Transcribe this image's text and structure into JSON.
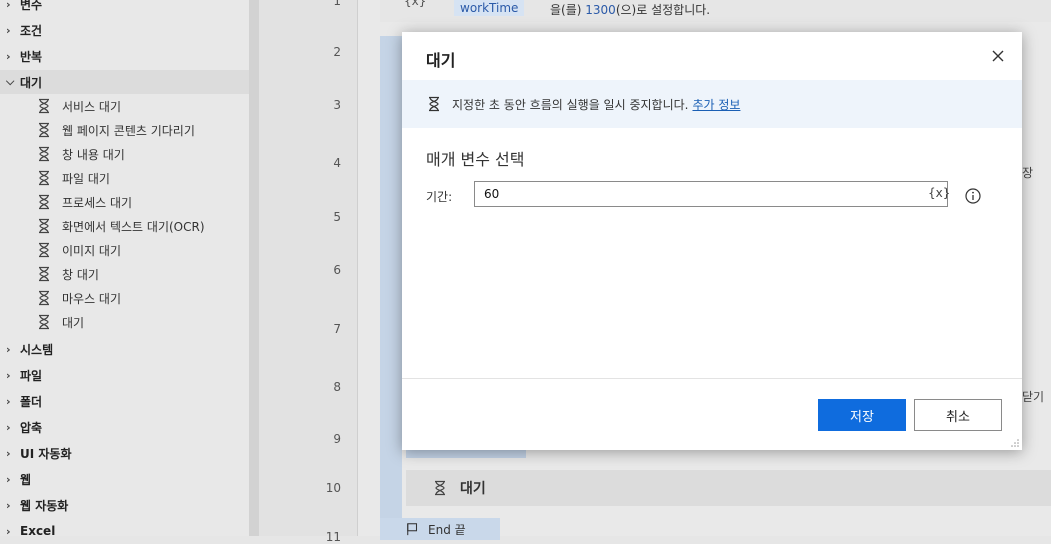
{
  "sidebar": {
    "categories_top": [
      {
        "label": "변수",
        "expanded": false
      },
      {
        "label": "조건",
        "expanded": false
      },
      {
        "label": "반복",
        "expanded": false
      },
      {
        "label": "대기",
        "expanded": true
      }
    ],
    "wait_children": [
      {
        "label": "서비스 대기",
        "icon": "hourglass-icon"
      },
      {
        "label": "웹 페이지 콘텐츠 기다리기",
        "icon": "hourglass-icon"
      },
      {
        "label": "창 내용 대기",
        "icon": "hourglass-icon"
      },
      {
        "label": "파일 대기",
        "icon": "hourglass-icon"
      },
      {
        "label": "프로세스 대기",
        "icon": "hourglass-icon"
      },
      {
        "label": "화면에서 텍스트 대기(OCR)",
        "icon": "hourglass-icon"
      },
      {
        "label": "이미지 대기",
        "icon": "hourglass-icon"
      },
      {
        "label": "창 대기",
        "icon": "hourglass-icon"
      },
      {
        "label": "마우스 대기",
        "icon": "hourglass-icon"
      },
      {
        "label": "대기",
        "icon": "hourglass-icon"
      }
    ],
    "categories_bottom": [
      {
        "label": "시스템"
      },
      {
        "label": "파일"
      },
      {
        "label": "폴더"
      },
      {
        "label": "압축"
      },
      {
        "label": "UI 자동화"
      },
      {
        "label": "웹"
      },
      {
        "label": "웹 자동화"
      },
      {
        "label": "Excel"
      }
    ]
  },
  "gutter": {
    "line_numbers": [
      "1",
      "2",
      "3",
      "4",
      "5",
      "6",
      "7",
      "8",
      "9",
      "10",
      "11"
    ]
  },
  "flow": {
    "row0_prefix": "{x}",
    "row0_var": "workTime",
    "row0_text_a": "을(를) ",
    "row0_value": "1300",
    "row0_text_b": "(으)로 설정합니다.",
    "wait_block_label": "대기",
    "end_label": "End 끝",
    "right_fragments": [
      "장",
      "닫기"
    ]
  },
  "modal": {
    "title": "대기",
    "info_text": "지정한 초 동안 흐름의 실행을 일시 중지합니다.",
    "info_link": "추가 정보",
    "section_title": "매개 변수 선택",
    "duration_label": "기간:",
    "duration_value": "60",
    "var_button": "{x}",
    "save_label": "저장",
    "cancel_label": "취소"
  },
  "colors": {
    "primary": "#0f6cde",
    "link": "#1a5fb4",
    "banner": "#eef4fb"
  }
}
